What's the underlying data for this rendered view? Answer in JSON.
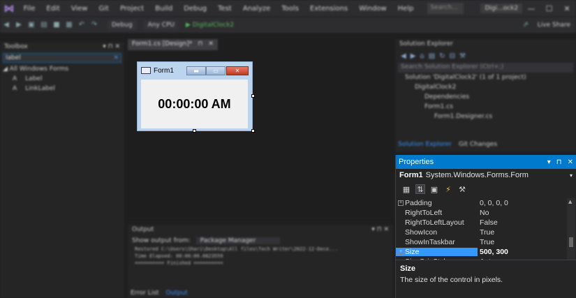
{
  "menubar": {
    "items": [
      "File",
      "Edit",
      "View",
      "Git",
      "Project",
      "Build",
      "Debug",
      "Test",
      "Analyze",
      "Tools",
      "Extensions",
      "Window",
      "Help"
    ],
    "search_placeholder": "Search...",
    "solution_title": "Digi...ock2",
    "window_controls": [
      "—",
      "☐",
      "✕"
    ]
  },
  "toolbar": {
    "config": "Debug",
    "platform": "Any CPU",
    "run_target": "DigitalClock2",
    "live_share": "Live Share"
  },
  "toolbox": {
    "title": "Toolbox",
    "search_value": "label",
    "group": "All Windows Forms",
    "items": [
      {
        "icon": "A",
        "label": "Label"
      },
      {
        "icon": "A",
        "label": "LinkLabel"
      }
    ]
  },
  "designer": {
    "tab_label": "Form1.cs [Design]*",
    "form": {
      "title": "Form1",
      "clock_text": "00:00:00 AM"
    }
  },
  "output": {
    "title": "Output",
    "show_from_label": "Show output from:",
    "source": "Package Manager",
    "lines": [
      "Restored C:\\Users\\Shari\\Desktop\\All files\\Tech Writer\\2022-12-Dece...",
      "Time Elapsed: 00:00:00.0823559",
      "========== Finished =========="
    ],
    "tabs": [
      "Error List",
      "Output"
    ]
  },
  "solution_explorer": {
    "title": "Solution Explorer",
    "search_placeholder": "Search Solution Explorer (Ctrl+;)",
    "tree": [
      {
        "label": "Solution 'DigitalClock2' (1 of 1 project)",
        "indent": 0
      },
      {
        "label": "DigitalClock2",
        "indent": 1
      },
      {
        "label": "Dependencies",
        "indent": 2
      },
      {
        "label": "Form1.cs",
        "indent": 2
      },
      {
        "label": "Form1.Designer.cs",
        "indent": 3
      }
    ],
    "tabs": [
      "Solution Explorer",
      "Git Changes"
    ]
  },
  "properties": {
    "title": "Properties",
    "object_name": "Form1",
    "object_type": "System.Windows.Forms.Form",
    "rows": [
      {
        "name": "Padding",
        "value": "0, 0, 0, 0",
        "expandable": true
      },
      {
        "name": "RightToLeft",
        "value": "No",
        "expandable": false
      },
      {
        "name": "RightToLeftLayout",
        "value": "False",
        "expandable": false
      },
      {
        "name": "ShowIcon",
        "value": "True",
        "expandable": false
      },
      {
        "name": "ShowInTaskbar",
        "value": "True",
        "expandable": false
      },
      {
        "name": "Size",
        "value": "500, 300",
        "expandable": true,
        "selected": true
      },
      {
        "name": "SizeGripStyle",
        "value": "Auto",
        "expandable": false
      }
    ],
    "description_title": "Size",
    "description_text": "The size of the control in pixels."
  },
  "colors": {
    "accent": "#007acc",
    "selection": "#3399ff",
    "close_button": "#c13a22"
  }
}
